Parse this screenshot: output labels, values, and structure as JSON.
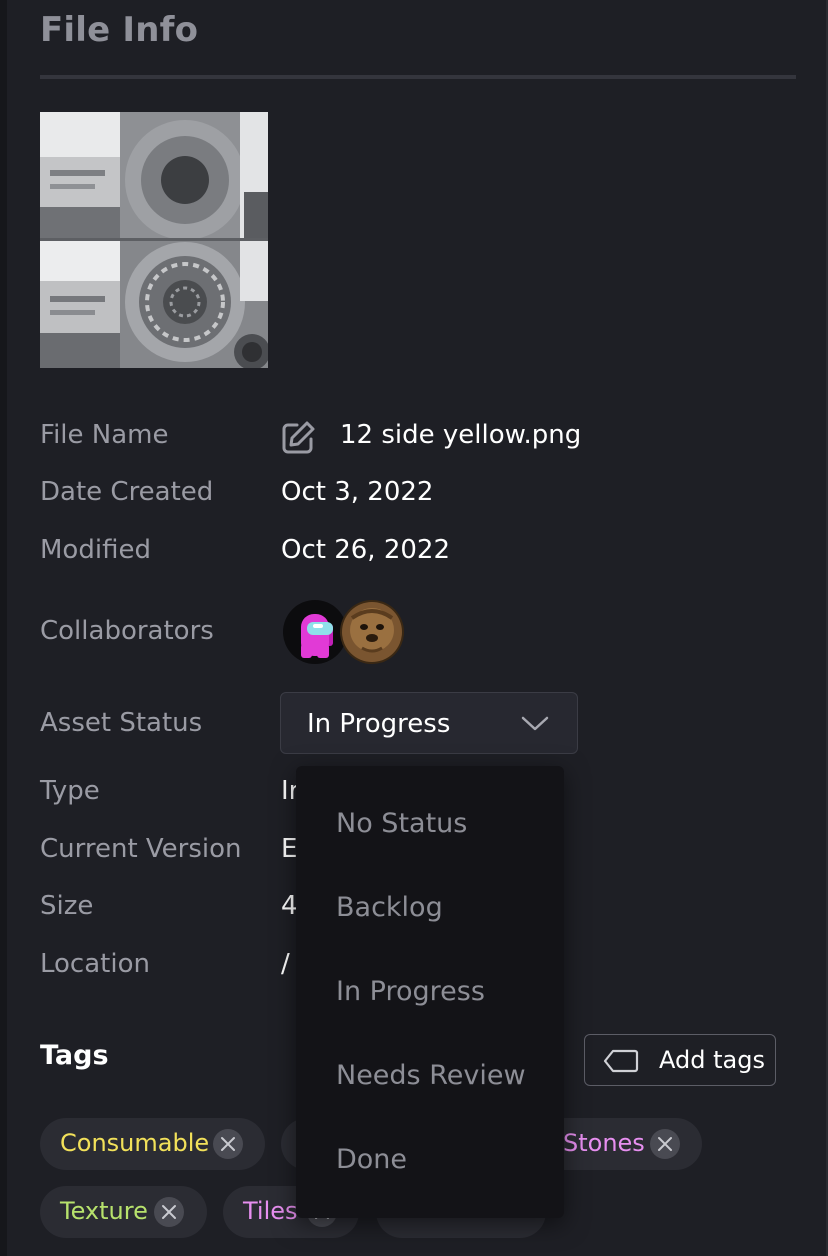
{
  "panel": {
    "title": "File Info"
  },
  "thumbnail": {
    "alt": "12 side yellow.png"
  },
  "info": {
    "file_name_label": "File Name",
    "file_name_value": "12 side yellow.png",
    "date_created_label": "Date Created",
    "date_created_value": "Oct 3, 2022",
    "modified_label": "Modified",
    "modified_value": "Oct 26, 2022",
    "collaborators_label": "Collaborators",
    "asset_status_label": "Asset Status",
    "type_label": "Type",
    "type_value_partial": "Ir",
    "current_version_label": "Current Version",
    "current_version_value_partial": "E",
    "size_label": "Size",
    "size_value_partial": "4",
    "location_label": "Location",
    "location_value_partial": "/"
  },
  "status_select": {
    "selected": "In Progress",
    "options": [
      "No Status",
      "Backlog",
      "In Progress",
      "Needs Review",
      "Done"
    ]
  },
  "tags": {
    "title": "Tags",
    "add_label": "Add tags",
    "items": [
      {
        "label": "Consumable",
        "color": "#f2e15a"
      },
      {
        "label": "Stones",
        "color": "#e78ff0"
      },
      {
        "label": "Texture",
        "color": "#b7e26c"
      },
      {
        "label": "Tiles",
        "color": "#e78ff0"
      }
    ]
  },
  "colors": {
    "background": "#1e1f25",
    "label": "#9a9ba4",
    "menu_bg": "#131317",
    "chip_bg": "#2b2c33"
  }
}
